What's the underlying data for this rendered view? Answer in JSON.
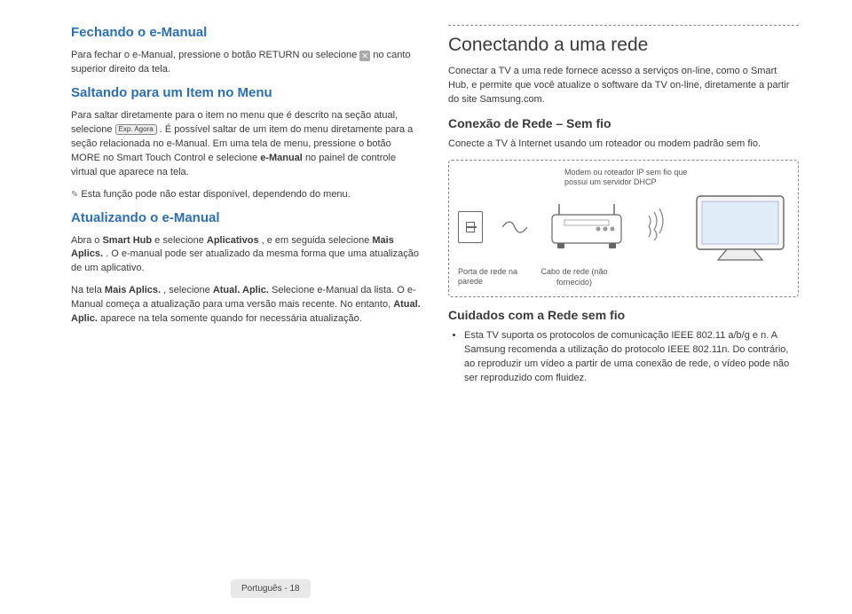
{
  "left": {
    "h1_1": "Fechando o e-Manual",
    "p1_pre": "Para fechar o e-Manual, pressione o botão RETURN ou selecione ",
    "close_glyph": "✕",
    "p1_post": " no canto superior direito da tela.",
    "h1_2": "Saltando para um Item no Menu",
    "p2_pre": "Para saltar diretamente para o item no menu que é descrito na seção atual, selecione ",
    "btn_label": "Exp. Agora",
    "p2_post": ". É possível saltar de um item do menu diretamente para a seção relacionada no e-Manual. Em uma tela de menu, pressione o botão MORE no Smart Touch Control e selecione ",
    "p2_b1": "e-Manual",
    "p2_tail": " no painel de controle virtual que aparece na tela.",
    "note": "Esta função pode não estar disponível, dependendo do menu.",
    "h1_3": "Atualizando o e-Manual",
    "p3a_pre": "Abra o ",
    "p3a_b1": "Smart Hub",
    "p3a_mid": " e selecione ",
    "p3a_b2": "Aplicativos",
    "p3a_mid2": ", e em seguida selecione ",
    "p3a_b3": "Mais Aplics.",
    "p3a_tail": ". O e-manual pode ser atualizado da mesma forma que uma atualização de um aplicativo.",
    "p3b_pre": "Na tela ",
    "p3b_b1": "Mais Aplics.",
    "p3b_mid": ", selecione ",
    "p3b_b2": "Atual. Aplic.",
    "p3b_mid2": " Selecione e-Manual da lista. O e-Manual começa a atualização para uma versão mais recente. No entanto, ",
    "p3b_b3": "Atual. Aplic.",
    "p3b_tail": " aparece na tela somente quando for necessária atualização."
  },
  "right": {
    "h1": "Conectando a uma rede",
    "p1": "Conectar a TV a uma rede fornece acesso a serviços on-line, como o Smart Hub, e permite que você atualize o software da TV on-line, diretamente a partir do site Samsung.com.",
    "h2": "Conexão de Rede – Sem fio",
    "p2": "Conecte a TV à Internet usando um roteador ou modem padrão sem fio.",
    "diagram": {
      "modem_label": "Modem ou roteador IP sem fio que possui um servidor DHCP",
      "port_label": "Porta de rede na parede",
      "cable_label": "Cabo de rede (não fornecido)"
    },
    "h2b": "Cuidados com a Rede sem fio",
    "bullet": "Esta TV suporta os protocolos de comunicação IEEE 802.11 a/b/g e n. A Samsung recomenda a utilização do protocolo IEEE 802.11n. Do contrário, ao reproduzir um vídeo a partir de uma conexão de rede, o vídeo pode não ser reproduzido com fluidez."
  },
  "footer": "Português - 18"
}
